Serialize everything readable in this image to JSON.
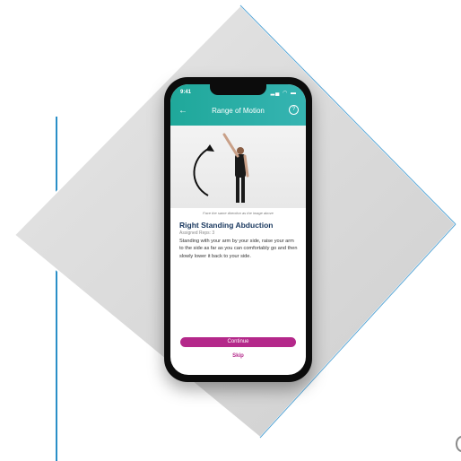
{
  "status_bar": {
    "time": "9:41",
    "indicators": "▂▄ ◠ ▬"
  },
  "header": {
    "title": "Range of Motion",
    "back_icon": "arrow-left-icon",
    "help_icon": "question-circle-icon",
    "help_glyph": "?"
  },
  "exercise": {
    "image_caption": "Face the same direction as the image above",
    "title": "Right Standing Abduction",
    "assigned_reps": "Assigned Reps: 3",
    "description": "Standing with your arm by your side, raise your arm to the side as far as you can comfortably go and then slowly lower it back to your side."
  },
  "actions": {
    "continue_label": "Continue",
    "skip_label": "Skip"
  },
  "colors": {
    "header": "#1fa89a",
    "accent": "#b4288a",
    "line": "#2a8fc7"
  }
}
